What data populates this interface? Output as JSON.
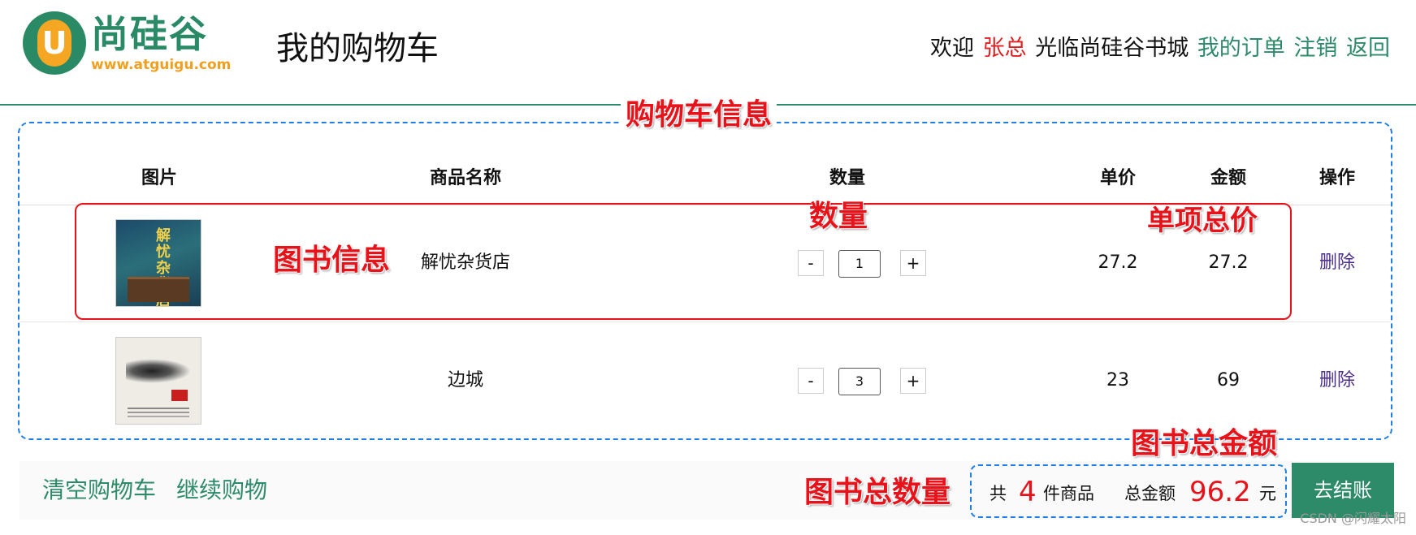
{
  "header": {
    "logo_text": "尚硅谷",
    "logo_letter": "U",
    "logo_url": "www.atguigu.com",
    "page_title": "我的购物车",
    "welcome_prefix": "欢迎",
    "username": "张总",
    "welcome_suffix": "光临尚硅谷书城",
    "nav": {
      "my_orders": "我的订单",
      "logout": "注销",
      "back": "返回"
    }
  },
  "annotations": {
    "cart_info": "购物车信息",
    "quantity": "数量",
    "item_total": "单项总价",
    "book_info": "图书信息",
    "grand_total": "图书总金额",
    "total_count": "图书总数量"
  },
  "table": {
    "columns": [
      "图片",
      "商品名称",
      "数量",
      "单价",
      "金额",
      "操作"
    ],
    "rows": [
      {
        "name": "解忧杂货店",
        "cover_text": "解忧杂货店",
        "quantity": "1",
        "price": "27.2",
        "amount": "27.2",
        "action": "删除"
      },
      {
        "name": "边城",
        "quantity": "3",
        "price": "23",
        "amount": "69",
        "action": "删除"
      }
    ],
    "minus_label": "-",
    "plus_label": "+"
  },
  "footer": {
    "clear_cart": "清空购物车",
    "continue_shopping": "继续购物",
    "count_prefix": "共",
    "total_count": "4",
    "count_suffix": "件商品",
    "amount_label": "总金额",
    "total_amount": "96.2",
    "currency": "元",
    "checkout": "去结账"
  },
  "watermark": "CSDN @闪耀太阳",
  "colors": {
    "brand_green": "#2e8b6a",
    "annotation_red": "#e8131a",
    "annotation_blue": "#1e7fe6",
    "username_red": "#e02020"
  }
}
